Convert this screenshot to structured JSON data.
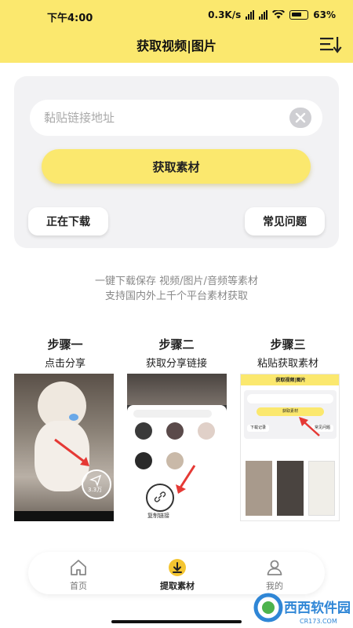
{
  "status_bar": {
    "time": "下午4:00",
    "speed": "0.3K/s",
    "battery": "63%"
  },
  "header": {
    "title": "获取视频|图片",
    "sort_icon": "sort-list-icon",
    "bg_color": "#fbe86e"
  },
  "panel": {
    "url_placeholder": "黏贴链接地址",
    "url_value": "",
    "get_button": "获取素材",
    "downloading_button": "正在下载",
    "faq_button": "常见问题"
  },
  "description": {
    "line1": "一键下载保存 视频/图片/音频等素材",
    "line2": "支持国内外上千个平台素材获取"
  },
  "steps": [
    {
      "title": "步骤一",
      "subtitle": "点击分享"
    },
    {
      "title": "步骤二",
      "subtitle": "获取分享链接"
    },
    {
      "title": "步骤三",
      "subtitle": "粘贴获取素材"
    }
  ],
  "step1_screen": {
    "share_count": "3.3万"
  },
  "step2_screen": {
    "copy_link_label": "复制链接"
  },
  "step3_screen": {
    "title": "获取视频|图片",
    "get_button": "获取素材",
    "downloading_button": "下载记录",
    "faq_button": "常见问题"
  },
  "tabbar": {
    "tabs": [
      {
        "label": "首页",
        "icon": "home-icon"
      },
      {
        "label": "提取素材",
        "icon": "download-icon"
      },
      {
        "label": "我的",
        "icon": "user-icon"
      }
    ],
    "active_index": 1
  },
  "watermark": {
    "text": "西西软件园",
    "url": "CR173.COM"
  }
}
